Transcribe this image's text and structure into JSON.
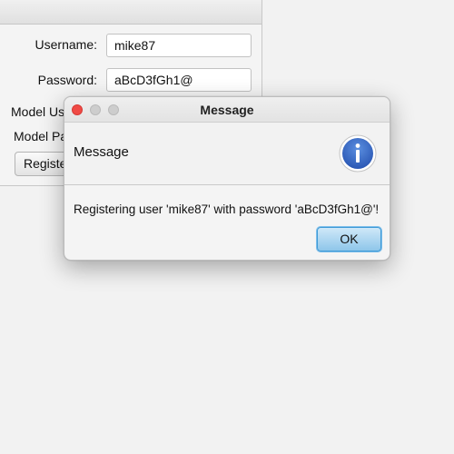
{
  "form": {
    "username_label": "Username:",
    "username_value": "mike87",
    "password_label": "Password:",
    "password_value": "aBcD3fGh1@",
    "model_user_label": "Model User",
    "model_pass_label": "Model Pass",
    "register_label": "Register"
  },
  "dialog": {
    "title": "Message",
    "header": "Message",
    "content": "Registering user 'mike87' with password 'aBcD3fGh1@'!",
    "ok_label": "OK",
    "icon": "info-icon"
  },
  "colors": {
    "close_button": "#f04a45",
    "ok_button_accent": "#3e9ad6",
    "info_icon_blue": "#2e63c4"
  }
}
